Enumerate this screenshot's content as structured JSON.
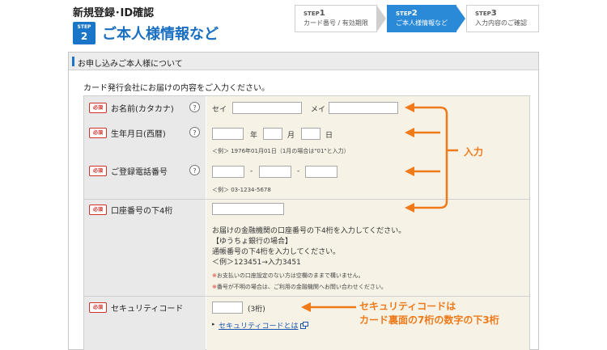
{
  "header": {
    "page_title": "新規登録･ID確認",
    "step_badge_label": "STEP",
    "step_badge_number": "2",
    "section_heading": "ご本人様情報など"
  },
  "steps": [
    {
      "label": "STEP",
      "number": "1",
      "text": "カード番号 / 有効期限"
    },
    {
      "label": "STEP",
      "number": "2",
      "text": "ご本人様情報など"
    },
    {
      "label": "STEP",
      "number": "3",
      "text": "入力内容のご確認"
    }
  ],
  "panel": {
    "heading": "お申し込みご本人様について",
    "intro": "カード発行会社にお届けの内容をご入力ください。"
  },
  "required_label": "必須",
  "help_symbol": "?",
  "fields": {
    "name": {
      "label": "お名前(カタカナ)",
      "sei": "セイ",
      "mei": "メイ"
    },
    "birthday": {
      "label": "生年月日(西暦)",
      "year": "年",
      "month": "月",
      "day": "日",
      "example": "＜例＞ 1976年01月01日（1月の場合は\"01\"と入力）"
    },
    "phone": {
      "label": "ご登録電話番号",
      "dash": "-",
      "example": "＜例＞ 03-1234-5678"
    },
    "account": {
      "label": "口座番号の下4桁",
      "desc": [
        "お届けの金融機関の口座番号の下4桁を入力してください。",
        "【ゆうちょ銀行の場合】",
        "通帳番号の下4桁を入力してください。",
        "＜例＞123451→入力3451"
      ],
      "notes": [
        "お支払いの口座設定のない方は空欄のままで構いません。",
        "番号が不明の場合は、ご利用の金融機関へお問い合わせください。"
      ],
      "note_mark": "※"
    },
    "security": {
      "label": "セキュリティコード",
      "digits": "(3桁)",
      "link": "セキュリティコードとは",
      "bullet": "▸",
      "external_icon": "external-window-icon"
    }
  },
  "callouts": {
    "input": "入力",
    "security_line1": "セキュリティコードは",
    "security_line2": "カード裏面の7桁の数字の下3桁"
  },
  "colors": {
    "accent_blue": "#1a75c9",
    "step_active": "#2a8ad8",
    "required_red": "#d3302a",
    "callout_orange": "#f07a1a"
  }
}
